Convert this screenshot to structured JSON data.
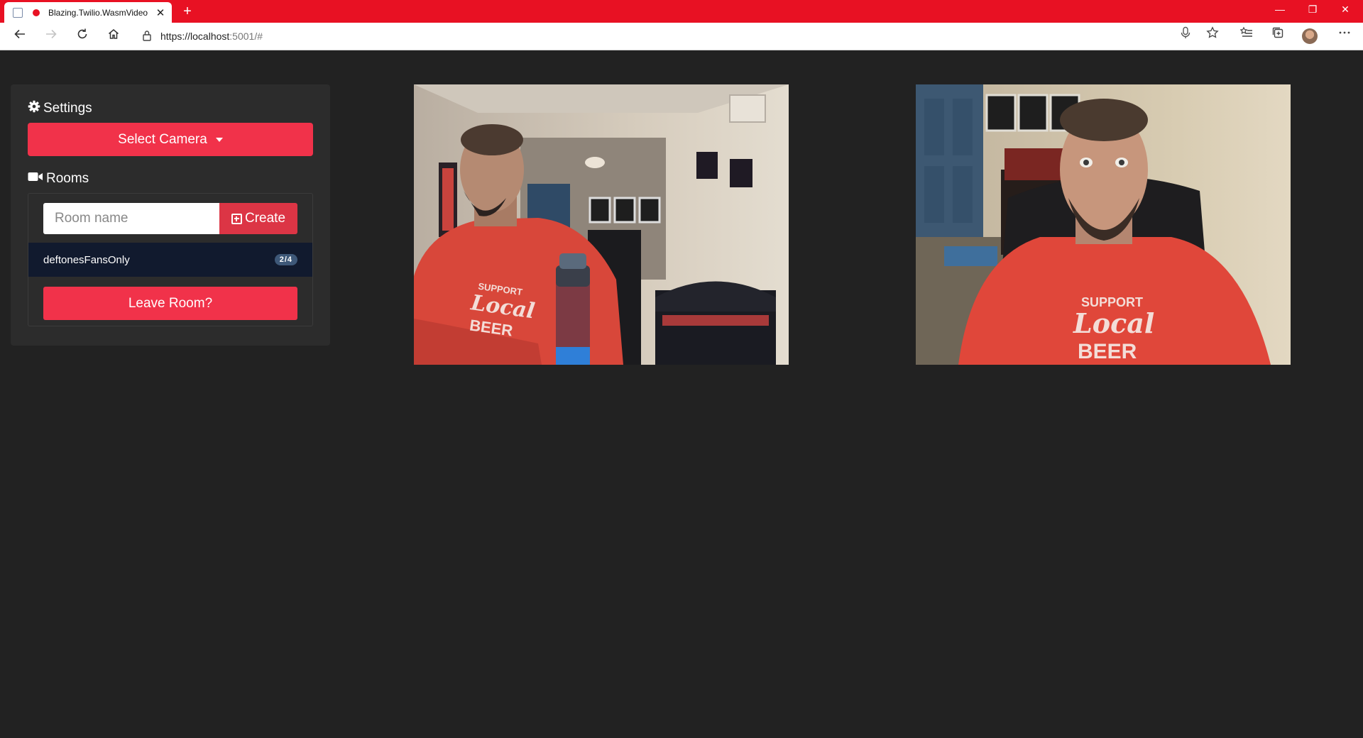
{
  "browser": {
    "tab_title": "Blazing.Twilio.WasmVideo",
    "tab_close": "✕",
    "new_tab": "+",
    "url_host": "https://localhost",
    "url_rest": ":5001/#",
    "window_controls": {
      "minimize": "—",
      "restore": "❐",
      "close": "✕"
    },
    "icons": [
      "back-icon",
      "forward-icon",
      "refresh-icon",
      "home-icon",
      "lock-icon",
      "microphone-icon",
      "favorite-star-icon",
      "favorites-list-icon",
      "collections-icon",
      "profile-avatar",
      "more-icon"
    ]
  },
  "settings": {
    "title": "Settings",
    "select_camera_label": "Select Camera"
  },
  "rooms": {
    "title": "Rooms",
    "room_name_placeholder": "Room name",
    "create_label": "Create",
    "list": [
      {
        "name": "deftonesFansOnly",
        "participants": "2/4"
      }
    ],
    "leave_label": "Leave Room?"
  },
  "videos": [
    {
      "shirt_line1": "SUPPORT",
      "shirt_line2": "Local",
      "shirt_line3": "BEER"
    },
    {
      "shirt_line1": "SUPPORT",
      "shirt_line2": "Local",
      "shirt_line3": "BEER"
    }
  ],
  "colors": {
    "titlebar": "#e81123",
    "page_bg": "#222222",
    "panel_bg": "#2c2c2c",
    "accent": "#f1324a",
    "room_row": "#111a2e"
  }
}
